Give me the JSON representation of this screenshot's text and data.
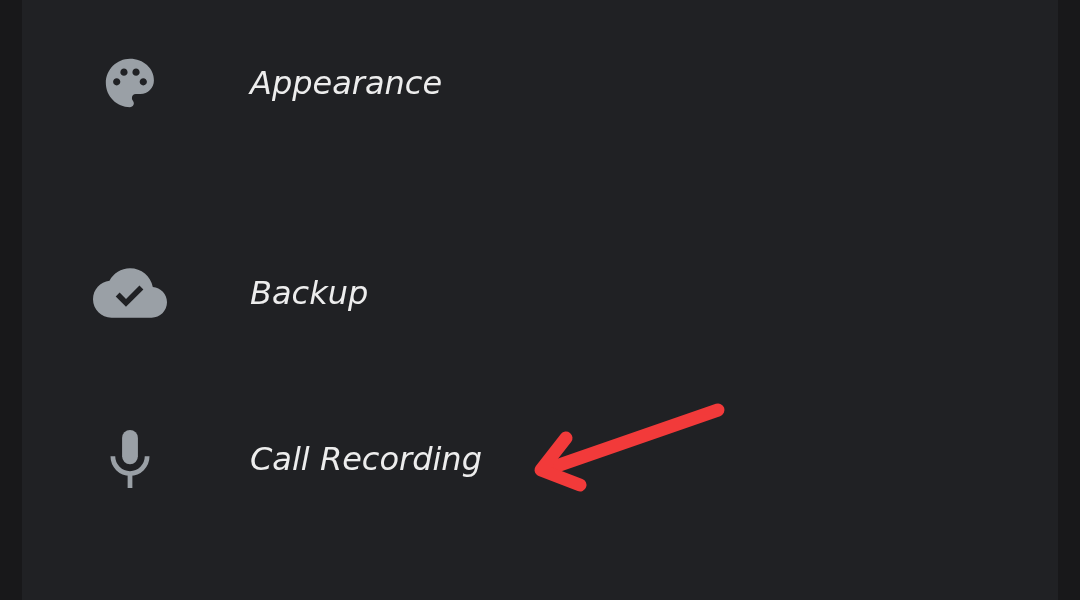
{
  "settings_items": [
    {
      "label": "Appearance",
      "kind": "palette"
    },
    {
      "label": "Backup",
      "kind": "cloud"
    },
    {
      "label": "Call Recording",
      "kind": "mic"
    }
  ]
}
